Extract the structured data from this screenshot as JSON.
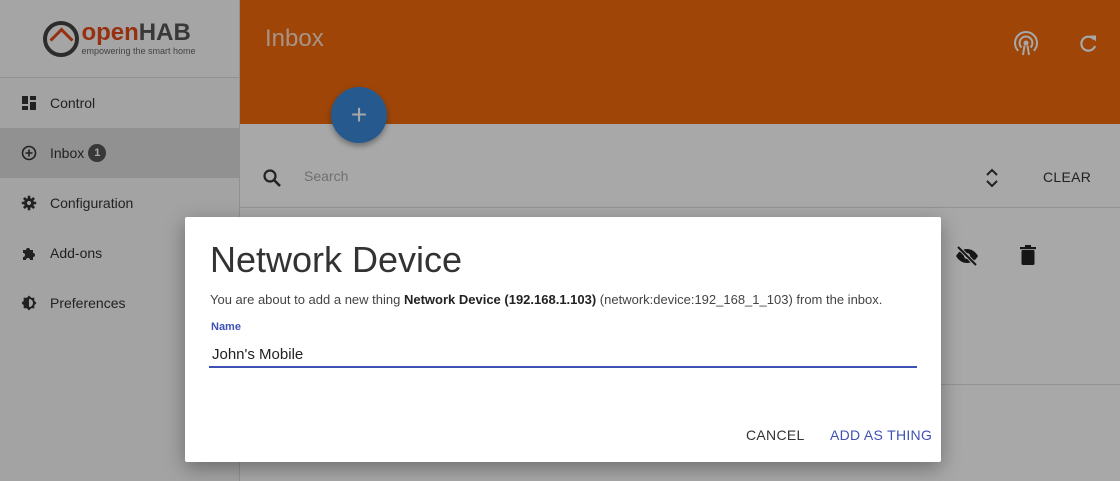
{
  "app": {
    "logo_name_part1": "open",
    "logo_name_part2": "HAB",
    "logo_tagline": "empowering the smart home"
  },
  "sidebar": {
    "items": [
      {
        "label": "Control",
        "icon": "dashboard-icon",
        "active": false
      },
      {
        "label": "Inbox",
        "icon": "add-circle-icon",
        "active": true,
        "badge": "1"
      },
      {
        "label": "Configuration",
        "icon": "gear-icon",
        "active": false
      },
      {
        "label": "Add-ons",
        "icon": "puzzle-icon",
        "active": false
      },
      {
        "label": "Preferences",
        "icon": "brightness-icon",
        "active": false
      }
    ]
  },
  "header": {
    "title": "Inbox",
    "accent_color": "#f06a0c"
  },
  "search": {
    "placeholder": "Search",
    "clear_label": "CLEAR"
  },
  "dialog": {
    "title": "Network Device",
    "message_prefix": "You are about to add a new thing ",
    "message_bold": "Network Device (192.168.1.103)",
    "message_suffix": " (network:device:192_168_1_103) from the inbox.",
    "field_label": "Name",
    "field_value": "John's Mobile",
    "cancel_label": "CANCEL",
    "confirm_label": "ADD AS THING",
    "primary_color": "#3f51b5"
  }
}
